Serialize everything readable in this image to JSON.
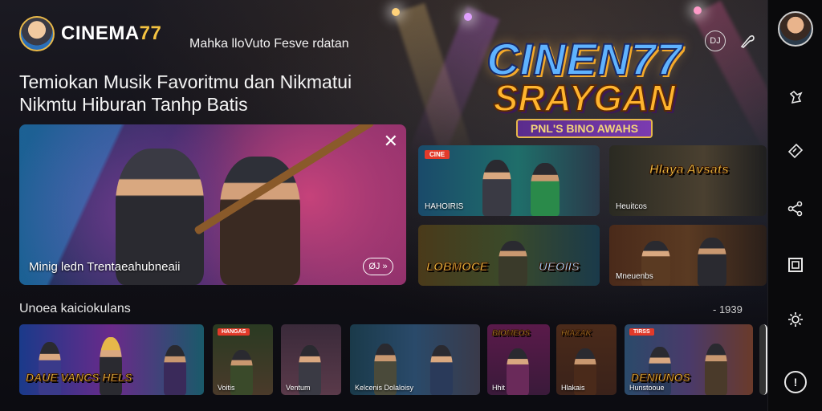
{
  "app": {
    "brand_prefix": "CINEMA",
    "brand_suffix": "77",
    "tagline": "Mahka lloVuto Fesve rdatan"
  },
  "hero_text": {
    "headline_line1": "Temiokan Musik Favoritmu dan Nikmatui",
    "headline_line2": "Nikmtu Hiburan Tanhp Batis"
  },
  "header_icons": {
    "dj_icon_text": "DJ",
    "icons": [
      "dj-icon",
      "guitar-pick-icon"
    ]
  },
  "banner_logo": {
    "line1": "CINEN77",
    "line2": "SRAYGAN",
    "ribbon": "PNL'S BINO AWAHS"
  },
  "hero_card": {
    "caption": "Minig ledn Trentaeahubneaii",
    "badge": "ØJ »",
    "close_glyph": "✕"
  },
  "grid_cards": [
    {
      "tag": "CINE",
      "big": "",
      "label": "HAHOIRIS"
    },
    {
      "tag": "",
      "big": "Hlaya Avsats",
      "label": "Heuitcos"
    },
    {
      "tag": "",
      "big": "LOBMOCE",
      "label": ""
    },
    {
      "tag": "",
      "big": "",
      "label": "Mneuenbs"
    }
  ],
  "grid_card_3_extra": "UEOIIS",
  "section": {
    "title": "Unoea kaiciokulans",
    "count": "- 1939"
  },
  "thumbnails": [
    {
      "tag": "",
      "big": "DAUE  VANCS HELS",
      "label": ""
    },
    {
      "tag": "HANGAS",
      "big": "",
      "label": "Voitis"
    },
    {
      "tag": "",
      "big": "",
      "label": "Ventum"
    },
    {
      "tag": "",
      "big": "",
      "label": "Kelcenis  Dolaloisy"
    },
    {
      "tag": "",
      "big": "BIOMEOS",
      "label": "Hhit"
    },
    {
      "tag": "",
      "big": "HIAZAK",
      "label": "Hlakais"
    },
    {
      "tag": "TIRSS",
      "big": "DENIUNOS",
      "label": "Hunstooue"
    }
  ],
  "sidebar_icons": [
    "profile-avatar",
    "pin-icon",
    "ticket-icon",
    "share-icon",
    "square-icon",
    "settings-icon",
    "help-icon"
  ],
  "colors": {
    "accent_gold": "#f4c341",
    "background": "#0b0b10",
    "sidebar": "#0a0a0c"
  }
}
